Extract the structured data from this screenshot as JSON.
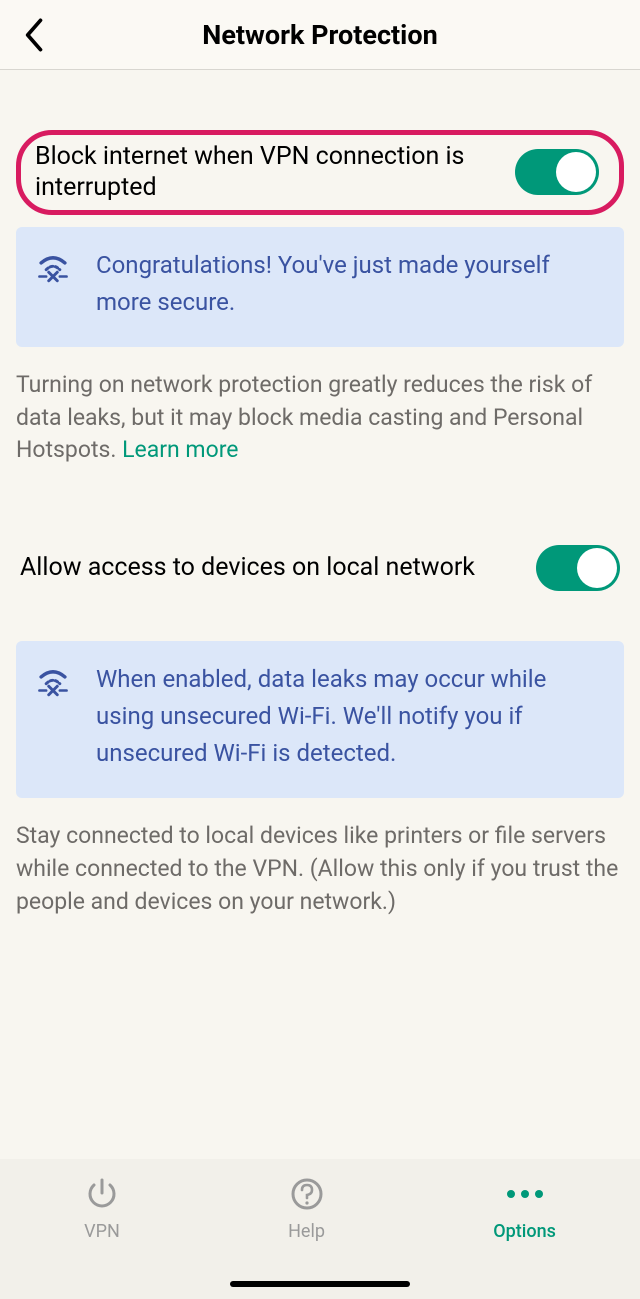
{
  "header": {
    "title": "Network Protection"
  },
  "section1": {
    "label": "Block internet when VPN connection is interrupted",
    "banner": "Congratulations! You've just made yourself more secure.",
    "desc": "Turning on network protection greatly reduces the risk of data leaks, but it may block media casting and Personal Hotspots. ",
    "learn_more": "Learn more"
  },
  "section2": {
    "label": "Allow access to devices on local network",
    "banner": "When enabled, data leaks may occur while using unsecured Wi-Fi. We'll notify you if unsecured Wi-Fi is detected.",
    "desc": "Stay connected to local devices like printers or file servers while connected to the VPN. (Allow this only if you trust the people and devices on your network.)"
  },
  "tabs": {
    "vpn": "VPN",
    "help": "Help",
    "options": "Options"
  }
}
